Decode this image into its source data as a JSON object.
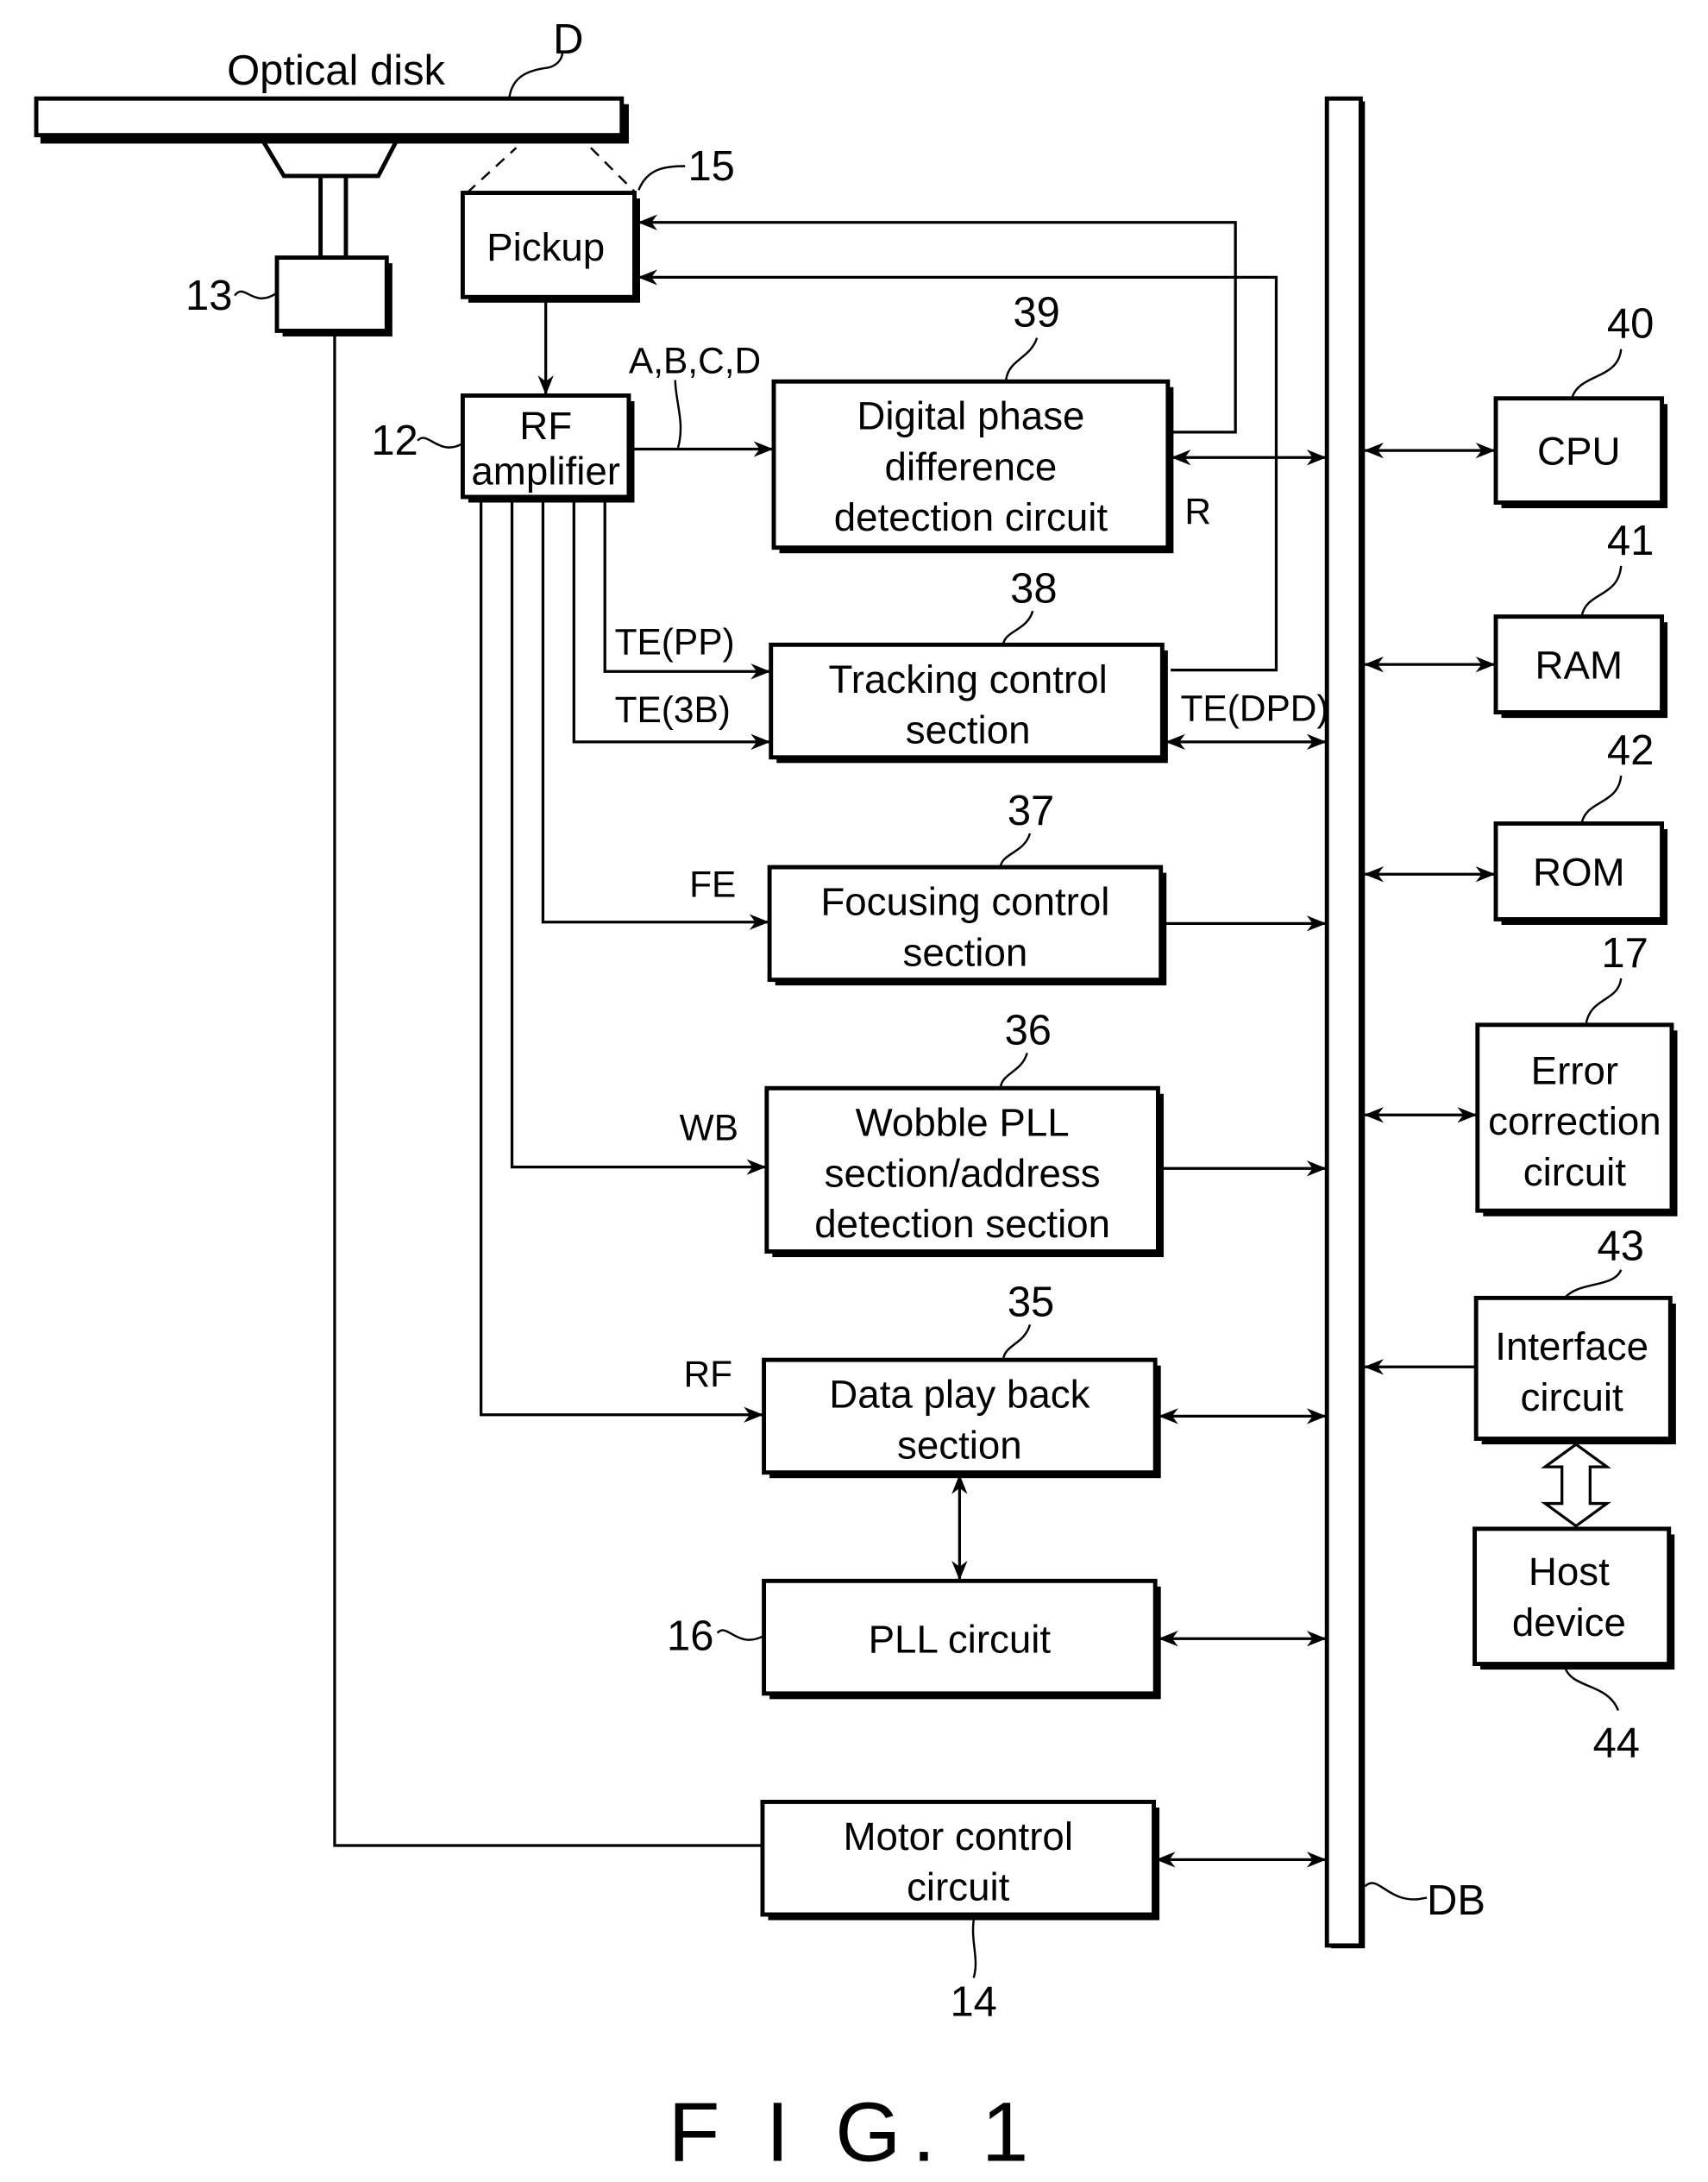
{
  "figure": {
    "caption": "F I G. 1",
    "disk_label": "Optical disk",
    "disk_ref": "D",
    "bus_ref": "DB"
  },
  "blocks": {
    "pickup": {
      "lines": [
        "Pickup"
      ],
      "ref": "15"
    },
    "motor": {
      "lines": [],
      "ref": "13"
    },
    "rf_amp": {
      "lines": [
        "RF",
        "amplifier"
      ],
      "ref": "12"
    },
    "dpd": {
      "lines": [
        "Digital phase",
        "difference",
        "detection circuit"
      ],
      "ref": "39"
    },
    "tracking": {
      "lines": [
        "Tracking control",
        "section"
      ],
      "ref": "38"
    },
    "focusing": {
      "lines": [
        "Focusing control",
        "section"
      ],
      "ref": "37"
    },
    "wobble": {
      "lines": [
        "Wobble PLL",
        "section/address",
        "detection section"
      ],
      "ref": "36"
    },
    "playback": {
      "lines": [
        "Data play back",
        "section"
      ],
      "ref": "35"
    },
    "pll": {
      "lines": [
        "PLL circuit"
      ],
      "ref": "16"
    },
    "motor_ctrl": {
      "lines": [
        "Motor control",
        "circuit"
      ],
      "ref": "14"
    },
    "cpu": {
      "lines": [
        "CPU"
      ],
      "ref": "40"
    },
    "ram": {
      "lines": [
        "RAM"
      ],
      "ref": "41"
    },
    "rom": {
      "lines": [
        "ROM"
      ],
      "ref": "42"
    },
    "ecc": {
      "lines": [
        "Error",
        "correction",
        "circuit"
      ],
      "ref": "17"
    },
    "iface": {
      "lines": [
        "Interface",
        "circuit"
      ],
      "ref": "43"
    },
    "host": {
      "lines": [
        "Host",
        "device"
      ],
      "ref": "44"
    }
  },
  "signals": {
    "abcd": "A,B,C,D",
    "r": "R",
    "te_pp": "TE(PP)",
    "te_3b": "TE(3B)",
    "te_dpd": "TE(DPD)",
    "fe": "FE",
    "wb": "WB",
    "rf": "RF"
  }
}
